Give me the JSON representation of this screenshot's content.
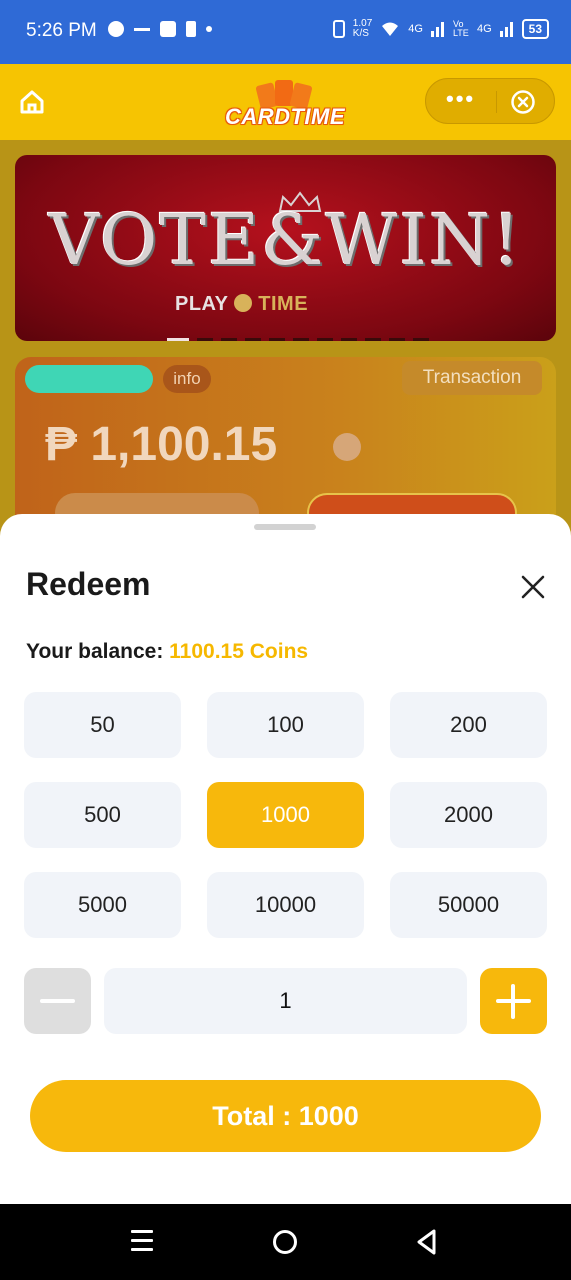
{
  "status_bar": {
    "time": "5:26 PM",
    "speed_top": "1.07",
    "speed_unit": "K/S",
    "net1": "4G",
    "volte": "Vo LTE",
    "net2": "4G",
    "battery": "53"
  },
  "app_header": {
    "logo_text": "CARDTIME",
    "more_icon": "more-dots-icon",
    "close_icon": "close-circle-icon",
    "home_icon": "home-icon"
  },
  "banner": {
    "headline": "VOTE&WIN!",
    "sponsor": "PLAY",
    "sponsor_suffix": "TIME"
  },
  "wallet": {
    "info_label": "info",
    "transaction_label": "Transaction",
    "amount": "₱ 1,100.15"
  },
  "redeem_sheet": {
    "title": "Redeem",
    "balance_label": "Your balance:",
    "balance_value": "1100.15 Coins",
    "options": [
      "50",
      "100",
      "200",
      "500",
      "1000",
      "2000",
      "5000",
      "10000",
      "50000"
    ],
    "selected_option": "1000",
    "quantity": "1",
    "total_label": "Total : 1000"
  },
  "colors": {
    "accent": "#f7b80c",
    "header": "#f6c402",
    "status_bar": "#2f6ad6"
  }
}
